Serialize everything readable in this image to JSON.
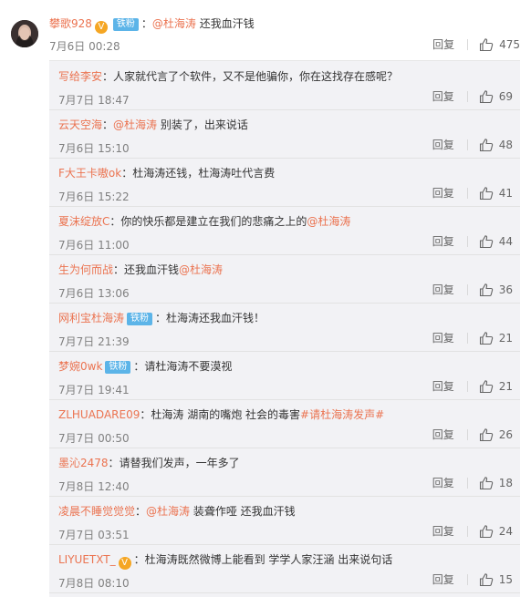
{
  "main_comment": {
    "user": "攀歌928",
    "verified": true,
    "badge": "铁粉",
    "separator": "：",
    "mention": "@杜海涛",
    "text": " 还我血汗钱",
    "time": "7月6日 00:28",
    "reply_label": "回复",
    "likes": "475"
  },
  "replies": [
    {
      "user": "写给李安",
      "badge": "",
      "separator": "：",
      "parts": [
        {
          "t": "人家就代言了个软件，又不是他骗你，你在这找存在感呢？",
          "m": false
        }
      ],
      "time": "7月7日 18:47",
      "reply_label": "回复",
      "likes": "69"
    },
    {
      "user": "云天空海",
      "badge": "",
      "separator": "：",
      "parts": [
        {
          "t": "@杜海涛",
          "m": true
        },
        {
          "t": " 别装了，出来说话",
          "m": false
        }
      ],
      "time": "7月6日 15:10",
      "reply_label": "回复",
      "likes": "48"
    },
    {
      "user": "F大王卡嗷ok",
      "badge": "",
      "separator": "：",
      "parts": [
        {
          "t": "杜海涛还钱，杜海涛吐代言费",
          "m": false
        }
      ],
      "time": "7月6日 15:22",
      "reply_label": "回复",
      "likes": "41"
    },
    {
      "user": "夏沫绽放C",
      "badge": "",
      "separator": "：",
      "parts": [
        {
          "t": "你的快乐都是建立在我们的悲痛之上的",
          "m": false
        },
        {
          "t": "@杜海涛",
          "m": true
        }
      ],
      "time": "7月6日 11:00",
      "reply_label": "回复",
      "likes": "44"
    },
    {
      "user": "生为何而战",
      "badge": "",
      "separator": "：",
      "parts": [
        {
          "t": "还我血汗钱",
          "m": false
        },
        {
          "t": "@杜海涛",
          "m": true
        }
      ],
      "time": "7月6日 13:06",
      "reply_label": "回复",
      "likes": "36"
    },
    {
      "user": "网利宝杜海涛",
      "badge": "铁粉",
      "separator": "：",
      "parts": [
        {
          "t": "杜海涛还我血汗钱！",
          "m": false
        }
      ],
      "time": "7月7日 21:39",
      "reply_label": "回复",
      "likes": "21"
    },
    {
      "user": "梦婉0wk",
      "badge": "铁粉",
      "separator": "：",
      "parts": [
        {
          "t": "请杜海涛不要漠视",
          "m": false
        }
      ],
      "time": "7月7日 19:41",
      "reply_label": "回复",
      "likes": "21"
    },
    {
      "user": "ZLHUADARE09",
      "badge": "",
      "separator": "：",
      "parts": [
        {
          "t": "杜海涛 湖南的嘴炮 社会的毒害",
          "m": false
        },
        {
          "t": "#请杜海涛发声#",
          "m": true
        }
      ],
      "time": "7月7日 00:50",
      "reply_label": "回复",
      "likes": "26"
    },
    {
      "user": "墨沁2478",
      "badge": "",
      "separator": "：",
      "parts": [
        {
          "t": "请替我们发声，一年多了",
          "m": false
        }
      ],
      "time": "7月8日 12:40",
      "reply_label": "回复",
      "likes": "18"
    },
    {
      "user": "凌晨不睡觉觉觉",
      "badge": "",
      "separator": "：",
      "parts": [
        {
          "t": "@杜海涛",
          "m": true
        },
        {
          "t": " 装聋作哑  还我血汗钱",
          "m": false
        }
      ],
      "time": "7月7日 03:51",
      "reply_label": "回复",
      "likes": "24"
    },
    {
      "user": "LIYUETXT_",
      "verified": true,
      "badge": "",
      "separator": "：",
      "parts": [
        {
          "t": "杜海涛既然微博上能看到 学学人家汪涵 出来说句话",
          "m": false
        }
      ],
      "time": "7月8日 08:10",
      "reply_label": "回复",
      "likes": "15"
    }
  ],
  "icons": {
    "like": "thumbs-up-icon",
    "verified": "verified-v-icon"
  },
  "colors": {
    "username": "#eb7350",
    "badge": "#5cb4e8",
    "panel": "#f2f2f5",
    "meta": "#808080"
  }
}
